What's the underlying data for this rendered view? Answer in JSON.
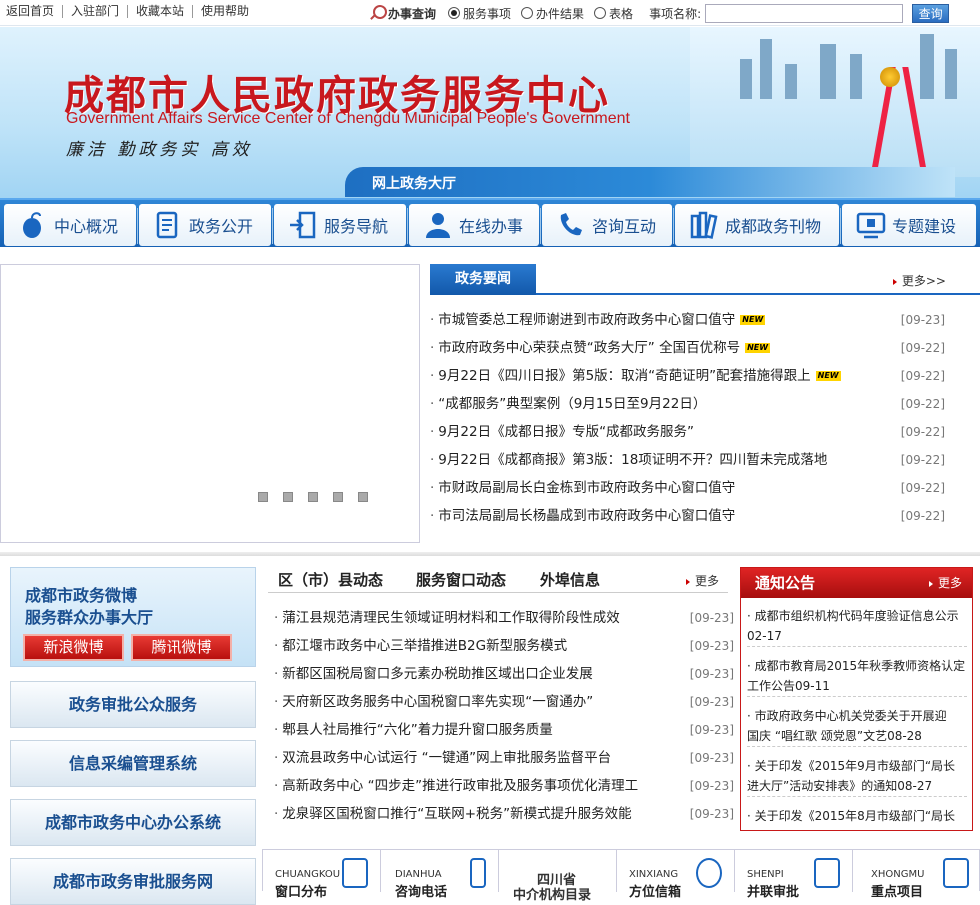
{
  "topbar": {
    "links": [
      "返回首页",
      "入驻部门",
      "收藏本站",
      "使用帮助"
    ],
    "search_title": "办事查询",
    "radios": [
      "服务事项",
      "办件结果",
      "表格"
    ],
    "selected_radio": "服务事项",
    "field_label": "事项名称:",
    "search_placeholder": "",
    "search_button": "查询"
  },
  "banner": {
    "title": "成都市人民政府政务服务中心",
    "subtitle": "Government Affairs Service Center of Chengdu Municipal People's Government",
    "slogan": "廉洁 勤政务实 高效",
    "hall": "网上政务大厅"
  },
  "nav": [
    {
      "label": "中心概况",
      "icon": "mouse-icon"
    },
    {
      "label": "政务公开",
      "icon": "document-icon"
    },
    {
      "label": "服务导航",
      "icon": "door-icon"
    },
    {
      "label": "在线办事",
      "icon": "user-icon"
    },
    {
      "label": "咨询互动",
      "icon": "phone-icon"
    },
    {
      "label": "成都政务刊物",
      "icon": "books-icon"
    },
    {
      "label": "专题建设",
      "icon": "monitor-icon"
    }
  ],
  "affairs_news": {
    "tab": "政务要闻",
    "more": "更多>>",
    "new_tag": "NEW",
    "items": [
      {
        "title": "市城管委总工程师谢进到市政府政务中心窗口值守",
        "date": "[09-23]",
        "new": true
      },
      {
        "title": "市政府政务中心荣获点赞“政务大厅” 全国百优称号",
        "date": "[09-22]",
        "new": true
      },
      {
        "title": "9月22日《四川日报》第5版：取消“奇葩证明”配套措施得跟上",
        "date": "[09-22]",
        "new": true
      },
      {
        "title": "“成都服务”典型案例（9月15日至9月22日）",
        "date": "[09-22]",
        "new": false
      },
      {
        "title": "9月22日《成都日报》专版“成都政务服务”",
        "date": "[09-22]",
        "new": false
      },
      {
        "title": "9月22日《成都商报》第3版：18项证明不开？四川暂未完成落地",
        "date": "[09-22]",
        "new": false
      },
      {
        "title": "市财政局副局长白金栋到市政府政务中心窗口值守",
        "date": "[09-22]",
        "new": false
      },
      {
        "title": "市司法局副局长杨畾成到市政府政务中心窗口值守",
        "date": "[09-22]",
        "new": false
      }
    ]
  },
  "weibo": {
    "line1": "成都市政务微博",
    "line2": "服务群众办事大厅",
    "sina": "新浪微博",
    "tencent": "腾讯微博"
  },
  "systems": [
    "政务审批公众服务",
    "信息采编管理系统",
    "成都市政务中心办公系统",
    "成都市政务审批服务网"
  ],
  "middle": {
    "tabs": [
      "区（市）县动态",
      "服务窗口动态",
      "外埠信息"
    ],
    "more": "更多",
    "items": [
      {
        "title": "蒲江县规范清理民生领域证明材料和工作取得阶段性成效",
        "date": "[09-23]"
      },
      {
        "title": "都江堰市政务中心三举措推进B2G新型服务模式",
        "date": "[09-23]"
      },
      {
        "title": "新都区国税局窗口多元素办税助推区域出口企业发展",
        "date": "[09-23]"
      },
      {
        "title": "天府新区政务服务中心国税窗口率先实现“一窗通办”",
        "date": "[09-23]"
      },
      {
        "title": "郫县人社局推行“六化”着力提升窗口服务质量",
        "date": "[09-23]"
      },
      {
        "title": "双流县政务中心试运行 “一键通”网上审批服务监督平台",
        "date": "[09-23]"
      },
      {
        "title": "高新政务中心 “四步走”推进行政审批及服务事项优化清理工",
        "date": "[09-23]"
      },
      {
        "title": "龙泉驿区国税窗口推行“互联网+税务”新模式提升服务效能",
        "date": "[09-23]"
      }
    ]
  },
  "notice": {
    "title": "通知公告",
    "more": "更多",
    "items": [
      {
        "l1": "成都市组织机构代码年度验证信息公示",
        "l2": "02-17"
      },
      {
        "l1": "成都市教育局2015年秋季教师资格认定",
        "l2": "工作公告09-11"
      },
      {
        "l1": "市政府政务中心机关党委关于开展迎",
        "l2": "国庆 “唱红歌 颂党恩”文艺08-28"
      },
      {
        "l1": "关于印发《2015年9月市级部门“局长",
        "l2": "进大厅”活动安排表》的通知08-27"
      },
      {
        "l1": "关于印发《2015年8月市级部门“局长",
        "l2": ""
      }
    ]
  },
  "bottom": [
    {
      "en": "CHUANGKOU",
      "cn": "窗口分布",
      "icon": "window-icon"
    },
    {
      "en": "DIANHUA",
      "cn": "咨询电话",
      "icon": "telephone-icon"
    },
    {
      "cn1": "四川省",
      "cn2": "中介机构目录",
      "icon": ""
    },
    {
      "en": "XINXIANG",
      "cn": "方位信箱",
      "icon": "mailbox-icon"
    },
    {
      "en": "SHENPI",
      "cn": "并联审批",
      "icon": "approval-icon"
    },
    {
      "en": "XHONGMU",
      "cn": "重点项目",
      "icon": "project-icon"
    }
  ]
}
